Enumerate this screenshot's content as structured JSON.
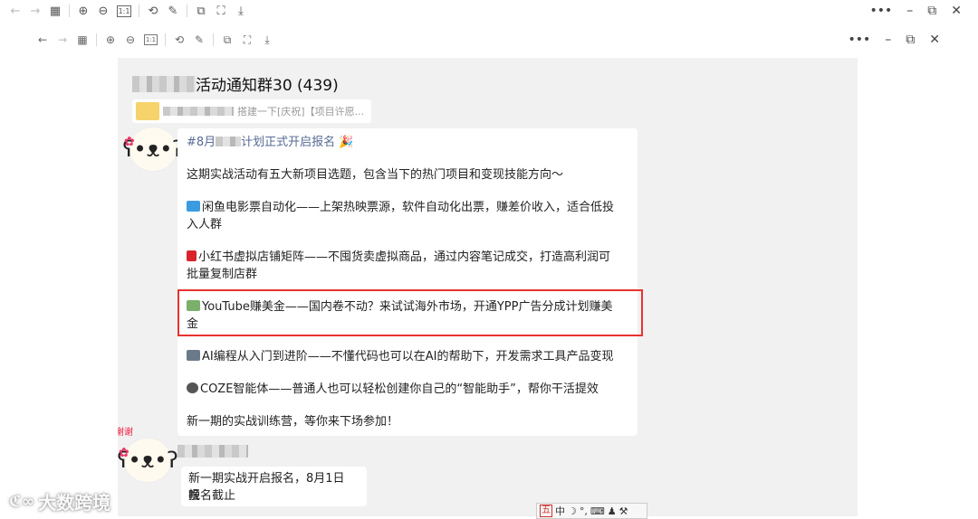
{
  "toolbar": {
    "back_icon": "arrow-left-icon",
    "forward_icon": "arrow-right-icon",
    "grid_icon": "grid-icon",
    "zoom_in_icon": "zoom-in-icon",
    "zoom_out_icon": "zoom-out-icon",
    "actual_size_label": "1:1",
    "window_more": "•••",
    "window_min": "–",
    "window_restore": "⧉",
    "window_close": "✕"
  },
  "chat": {
    "group_name": "活动通知群30 (439)",
    "pinned_text": "搭建一下[庆祝]【项目许愿..."
  },
  "message1": {
    "line1_hashtag": "#8月",
    "line1_hashtag_rest": "计划正式开启报名",
    "line2": "这期实战活动有五大新项目选题，包含当下的热门项目和变现技能方向～",
    "item1_a": "闲鱼电影票自动化——上架热映票源，软件自动化出票，赚差价收入，适合低投",
    "item1_b": "入人群",
    "item2_a": "小红书虚拟店铺矩阵——不囤货卖虚拟商品，通过内容笔记成交，打造高利润可",
    "item2_b": "批量复制店群",
    "item3_a": "YouTube赚美金——国内卷不动？来试试海外市场，开通YPP广告分成计划赚美",
    "item3_b": "金",
    "item4": "AI编程从入门到进阶——不懂代码也可以在AI的帮助下，开发需求工具产品变现",
    "item5": "COZE智能体——普通人也可以轻松创建你自己的“智能助手”，帮你干活提效",
    "closing": "新一期的实战训练营，等你来下场参加！"
  },
  "message2": {
    "line_a": "新一期实战开启报名，8月1日晚",
    "line_b": "报名截止"
  },
  "avatar_tag": "谢谢",
  "ime": {
    "mode": "五",
    "lang": "中"
  },
  "watermark": {
    "text": "大数跨境"
  },
  "colors": {
    "highlight_border": "#e8332f",
    "chat_bg": "#f1f1f1",
    "hashtag": "#576b95"
  }
}
